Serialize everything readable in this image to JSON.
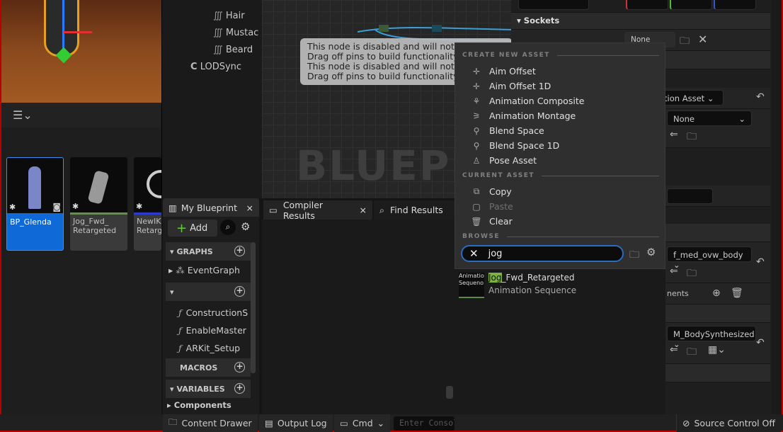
{
  "viewport": {
    "label": "3D viewport"
  },
  "content_browser": {
    "assets": [
      {
        "name": "BP_Glenda",
        "selected": true
      },
      {
        "name": "Jog_Fwd_\nRetargeted",
        "selected": false
      },
      {
        "name": "NewIK\nRetarge",
        "selected": false
      }
    ]
  },
  "component_tree": {
    "items": [
      "Hair",
      "Mustac",
      "Beard",
      "LODSync"
    ]
  },
  "graph": {
    "watermark": "BLUEPRINT",
    "comment_lines": [
      "This node is disabled and will not be",
      "Drag off pins to build functionality.",
      "This node is disabled and will not be",
      "Drag off pins to build functionality."
    ]
  },
  "my_blueprint": {
    "tab": "My Blueprint",
    "add_label": "Add",
    "graphs_label": "GRAPHS",
    "event_graph": "EventGraph",
    "functions": [
      "ConstructionS",
      "EnableMaster",
      "ARKit_Setup"
    ],
    "macros_label": "MACROS",
    "variables_label": "VARIABLES",
    "components_label": "Components"
  },
  "bottom_tabs": {
    "compiler": "Compiler Results",
    "find": "Find Results"
  },
  "details": {
    "sockets": "Sockets",
    "none1": "None",
    "anim_asset": "ation Asset",
    "none2": "None",
    "body": "f_med_ovw_body",
    "elements": "nents",
    "material": "M_BodySynthesized"
  },
  "popup": {
    "create_header": "CREATE NEW ASSET",
    "create_items": [
      "Aim Offset",
      "Aim Offset 1D",
      "Animation Composite",
      "Animation Montage",
      "Blend Space",
      "Blend Space 1D",
      "Pose Asset"
    ],
    "current_header": "CURRENT ASSET",
    "current_items": [
      {
        "label": "Copy",
        "enabled": true
      },
      {
        "label": "Paste",
        "enabled": false
      },
      {
        "label": "Clear",
        "enabled": true
      }
    ],
    "browse_header": "BROWSE",
    "search_value": "jog",
    "result": {
      "highlight": "Jog",
      "rest": "_Fwd_Retargeted",
      "type": "Animation Sequence",
      "thumb_text": "Animatio Sequeno"
    },
    "highlight_color": "#7cb342"
  },
  "status_bar": {
    "content_drawer": "Content Drawer",
    "output_log": "Output Log",
    "cmd": "Cmd",
    "console_placeholder": "Enter Console Command",
    "source_control": "Source Control Off"
  }
}
